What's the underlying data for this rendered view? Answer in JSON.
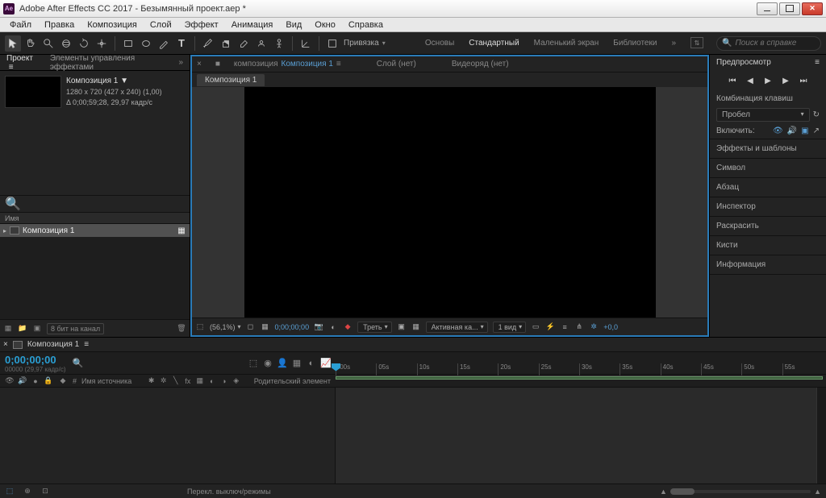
{
  "titlebar": {
    "icon_label": "Ae",
    "title": "Adobe After Effects CC 2017 - Безымянный проект.aep *"
  },
  "menus": [
    "Файл",
    "Правка",
    "Композиция",
    "Слой",
    "Эффект",
    "Анимация",
    "Вид",
    "Окно",
    "Справка"
  ],
  "toolbar": {
    "snap_label": "Привязка",
    "workspaces": [
      "Основы",
      "Стандартный",
      "Маленький экран",
      "Библиотеки"
    ],
    "active_workspace": "Стандартный",
    "search_placeholder": "Поиск в справке"
  },
  "project": {
    "tab_project": "Проект",
    "tab_effects": "Элементы управления эффектами",
    "comp_name": "Композиция 1 ▼",
    "comp_dims": "1280 x 720   (427 x 240) (1,00)",
    "comp_dur": "Δ 0;00;59;28, 29,97 кадр/с",
    "col_name": "Имя",
    "item_name": "Композиция 1",
    "bpc": "8 бит на канал"
  },
  "viewer": {
    "crumb_prefix": "композиция",
    "crumb_link": "Композиция 1",
    "layer_none": "Слой (нет)",
    "footage_none": "Видеоряд (нет)",
    "subtab": "Композиция 1",
    "zoom": "(56,1%)",
    "timecode": "0;00;00;00",
    "channels": "Треть",
    "active_cam": "Активная ка...",
    "views": "1 вид",
    "exposure": "+0,0"
  },
  "sidebar": {
    "preview": "Предпросмотр",
    "shortcut_label": "Комбинация клавиш",
    "shortcut_value": "Пробел",
    "include_label": "Включить:",
    "panels": [
      "Эффекты и шаблоны",
      "Символ",
      "Абзац",
      "Инспектор",
      "Раскрасить",
      "Кисти",
      "Информация"
    ]
  },
  "timeline": {
    "tab": "Композиция 1",
    "timecode": "0;00;00;00",
    "sub_tc": "00000 (29,97 кадр/с)",
    "source_col": "Имя источника",
    "parent_col": "Родительский элемент",
    "marks": [
      ":00s",
      "05s",
      "10s",
      "15s",
      "20s",
      "25s",
      "30s",
      "35s",
      "40s",
      "45s",
      "50s",
      "55s"
    ],
    "footer_text": "Перекл. выключ/режимы"
  }
}
